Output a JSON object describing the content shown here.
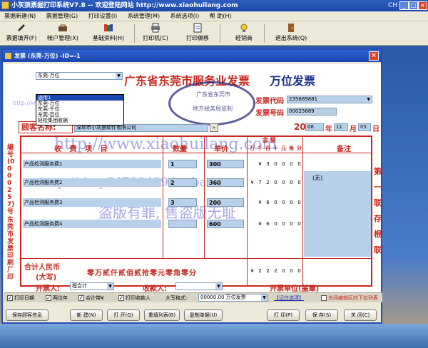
{
  "app": {
    "title": "小灰狼票据打印系统V7.8 -- 欢迎登陆网站 http://www.xiaohuilang.com",
    "tray_label": "CH",
    "menu": [
      "票据新建(N)",
      "票据管理(G)",
      "打印设置(I)",
      "系统管理(M)",
      "系统选项(I)",
      "帮 助(H)"
    ],
    "toolbar": [
      "票据填开(F)",
      "帐户管理(X)",
      "基础资料(H)",
      "打印机(C)",
      "打印偏移",
      "经销商",
      "退出系统(Q)"
    ]
  },
  "dialog": {
    "title": "发票 (东莞-万位) -ID=-1",
    "close_label": "×"
  },
  "invoice": {
    "template_select": "东莞-万位",
    "template_options": [
      "通用1",
      "东莞-万位",
      "东莞-千位",
      "东莞-百位",
      "轻松集团收据"
    ],
    "template_selected_index": 0,
    "heading": "广东省东莞市服务业发票",
    "heading_suffix": "万位发票",
    "seal_text": [
      "广东省东莞市",
      "地方税务局监制"
    ],
    "invoice_code_label": "发票代码",
    "invoice_code": "235689881",
    "invoice_no_label": "发票号码",
    "invoice_no": "00025689",
    "customer_label": "顾客名称:",
    "customer_name": "深圳市小灰狼软件有限公司",
    "date": {
      "year_prefix": "20",
      "year": "08",
      "year_label": "年",
      "month": "11",
      "month_label": "月",
      "day": "05",
      "day_label": "日"
    },
    "side_left": "编号(0000257)号",
    "side_left2": "东莞市发票印刷厂印",
    "side_right": [
      "第",
      "一",
      "联",
      "存",
      "根",
      "联"
    ],
    "col_item": "收 费 项 目",
    "col_qty": "数量",
    "col_price": "单价",
    "col_amount": "金  额",
    "col_digits": [
      "万",
      "千",
      "百",
      "十",
      "元",
      "角",
      "分"
    ],
    "col_remark": "备注",
    "rows": [
      {
        "name": "产品检测服务费1",
        "qty": "1",
        "price": "300",
        "digits": [
          "",
          "¥",
          "3",
          "0",
          "0",
          "0",
          "0"
        ]
      },
      {
        "name": "产品检测服务费2",
        "qty": "2",
        "price": "360",
        "digits": [
          "¥",
          "7",
          "2",
          "0",
          "0",
          "0",
          "0"
        ]
      },
      {
        "name": "产品检测服务费3",
        "qty": "3",
        "price": "200",
        "digits": [
          "",
          "¥",
          "6",
          "0",
          "0",
          "0",
          "0"
        ]
      },
      {
        "name": "产品检测服务费4",
        "qty": "",
        "price": "600",
        "digits": [
          "",
          "¥",
          "6",
          "0",
          "0",
          "0",
          "0"
        ]
      }
    ],
    "remark": "(无)",
    "total_label": "合计人民币",
    "total_label2": "(大写)",
    "total_words": "零万贰仟贰佰贰拾零元零角零分",
    "total_digits": [
      "¥",
      "2",
      "2",
      "2",
      "0",
      "0",
      "0"
    ],
    "payee_label": "开票人:",
    "payee": "程合计",
    "collector_label": "收款人:",
    "seal_label": "开票单位(盖章)",
    "watermarks": [
      "http://www.xiaohuilang.com",
      "http://shop34789489.taobao.com",
      "盗版有罪, 售盗版无耻"
    ]
  },
  "bottom": {
    "checks": [
      {
        "label": "打印日期",
        "checked": true
      },
      {
        "label": "两位年",
        "checked": true
      },
      {
        "label": "合计带¥",
        "checked": true
      },
      {
        "label": "打印收款人",
        "checked": true
      }
    ],
    "format_label": "大写格式:",
    "format_value": "00000.00 万位发票",
    "remember_option": "【记住选项】",
    "close_dropdown_label": "关闭编辑区的下拉列表",
    "buttons": [
      "保存顾客信息",
      "新  建(N)",
      "打  开(Q)",
      "重填列表(B)",
      "复制单据(U)",
      "打  印(P)",
      "保  存(S)",
      "关  闭(C)"
    ]
  }
}
